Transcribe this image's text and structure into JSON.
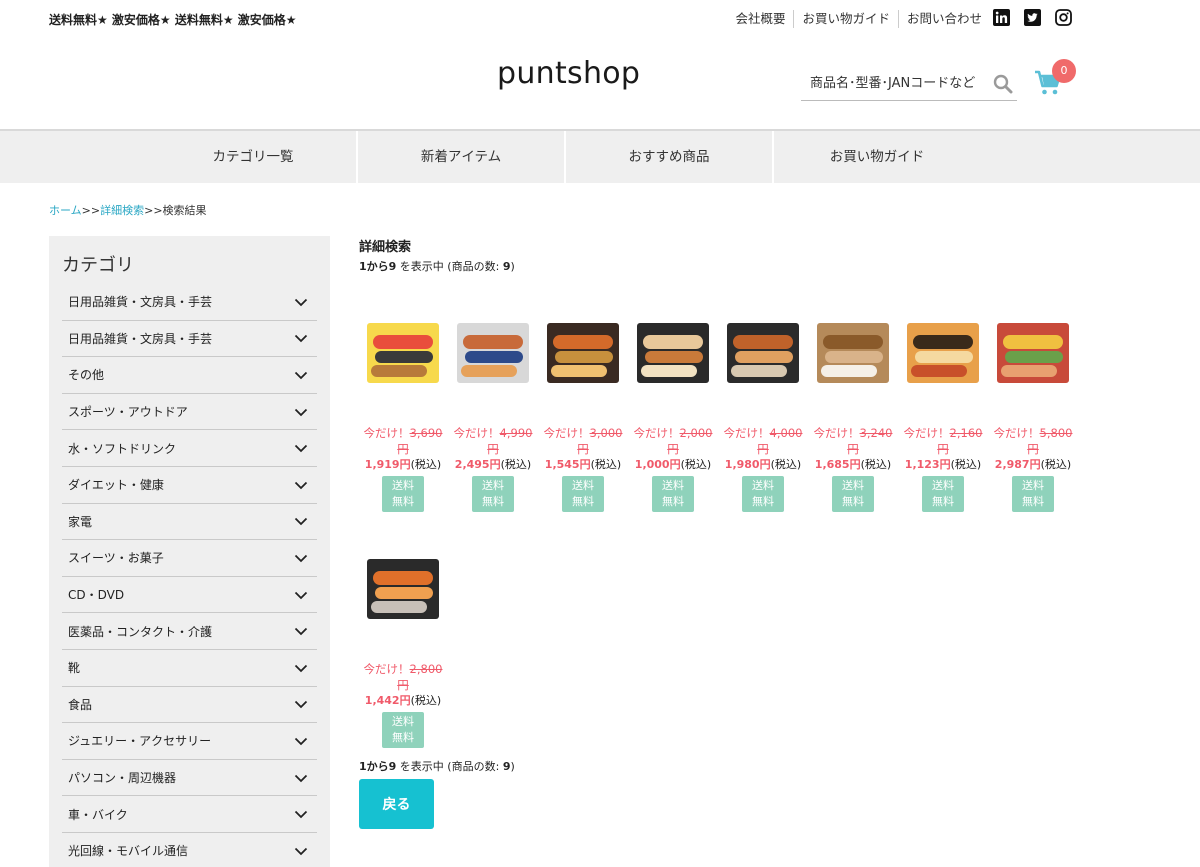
{
  "header": {
    "announcement": "送料無料★ 激安価格★ 送料無料★ 激安価格★",
    "links": [
      "会社概要",
      "お買い物ガイド",
      "お問い合わせ"
    ],
    "social": [
      "linkedin-icon",
      "twitter-icon",
      "instagram-icon"
    ],
    "logo": "puntshop",
    "search_placeholder": "商品名･型番･JANコードなど",
    "cart_count": "0"
  },
  "nav": {
    "items": [
      "カテゴリ一覧",
      "新着アイテム",
      "おすすめ商品",
      "お買い物ガイド"
    ]
  },
  "breadcrumb": {
    "home": "ホーム",
    "sep1": ">>",
    "advanced": "詳細検索",
    "sep2": ">>",
    "current": "検索結果"
  },
  "sidebar": {
    "heading": "カテゴリ",
    "categories": [
      "日用品雑貨・文房具・手芸",
      "日用品雑貨・文房具・手芸",
      "その他",
      "スポーツ・アウトドア",
      "水・ソフトドリンク",
      "ダイエット・健康",
      "家電",
      "スイーツ・お菓子",
      "CD・DVD",
      "医薬品・コンタクト・介護",
      "靴",
      "食品",
      "ジュエリー・アクセサリー",
      "パソコン・周辺機器",
      "車・バイク",
      "光回線・モバイル通信"
    ]
  },
  "results": {
    "title": "詳細検索",
    "count_range": "1から9",
    "count_text": " を表示中 (商品の数: ",
    "count_total": "9",
    "count_close": ")",
    "products": [
      {
        "promo_prefix": "今だけ！",
        "old_price": "3,690円",
        "price": "1,919円",
        "tax": "(税込)",
        "badge": [
          "送料",
          "無料"
        ]
      },
      {
        "promo_prefix": "今だけ！",
        "old_price": "4,990円",
        "price": "2,495円",
        "tax": "(税込)",
        "badge": [
          "送料",
          "無料"
        ]
      },
      {
        "promo_prefix": "今だけ！",
        "old_price": "3,000円",
        "price": "1,545円",
        "tax": "(税込)",
        "badge": [
          "送料",
          "無料"
        ]
      },
      {
        "promo_prefix": "今だけ！",
        "old_price": "2,000円",
        "price": "1,000円",
        "tax": "(税込)",
        "badge": [
          "送料",
          "無料"
        ]
      },
      {
        "promo_prefix": "今だけ！",
        "old_price": "4,000円",
        "price": "1,980円",
        "tax": "(税込)",
        "badge": [
          "送料",
          "無料"
        ]
      },
      {
        "promo_prefix": "今だけ！",
        "old_price": "3,240円",
        "price": "1,685円",
        "tax": "(税込)",
        "badge": [
          "送料",
          "無料"
        ]
      },
      {
        "promo_prefix": "今だけ！",
        "old_price": "2,160円",
        "price": "1,123円",
        "tax": "(税込)",
        "badge": [
          "送料",
          "無料"
        ]
      },
      {
        "promo_prefix": "今だけ！",
        "old_price": "5,800円",
        "price": "2,987円",
        "tax": "(税込)",
        "badge": [
          "送料",
          "無料"
        ]
      },
      {
        "promo_prefix": "今だけ！",
        "old_price": "2,800円",
        "price": "1,442円",
        "tax": "(税込)",
        "badge": [
          "送料",
          "無料"
        ]
      }
    ],
    "back_label": "戻る"
  },
  "colors": {
    "accent": "#16c1d1",
    "sale": "#f05a6a",
    "badge": "#8fd2bb",
    "cart_badge": "#f06a6a"
  }
}
